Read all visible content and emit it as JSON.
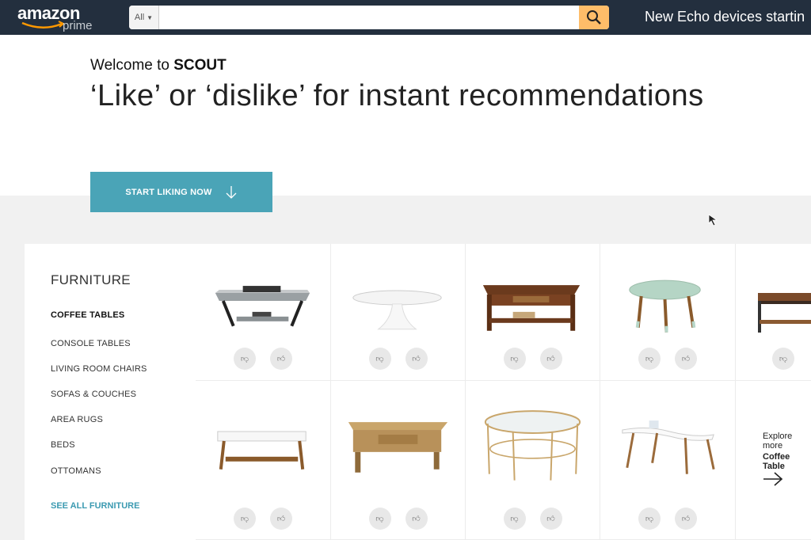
{
  "header": {
    "logo_word": "amazon",
    "logo_sub": "prime",
    "search_dept": "All",
    "search_placeholder": "",
    "promo": "New Echo devices startin"
  },
  "hero": {
    "welcome_prefix": "Welcome to",
    "welcome_brand": "SCOUT",
    "headline": "‘Like’ or ‘dislike’ for instant  recommendations",
    "cta_label": "START LIKING NOW"
  },
  "categories": {
    "title": "FURNITURE",
    "items": [
      "COFFEE TABLES",
      "CONSOLE TABLES",
      "LIVING ROOM CHAIRS",
      "SOFAS & COUCHES",
      "AREA RUGS",
      "BEDS",
      "OTTOMANS"
    ],
    "active": "COFFEE TABLES",
    "see_all": "SEE ALL FURNITURE"
  },
  "explore": {
    "line1": "Explore more",
    "line2": "Coffee Table"
  },
  "colors": {
    "header_bg": "#232f3e",
    "search_button": "#febd69",
    "accent_teal": "#4aa4b7",
    "link_teal": "#3b9ab1"
  },
  "icons": {
    "search": "magnifier-icon",
    "cta": "arrow-down-icon",
    "dislike": "thumbs-down-icon",
    "like": "thumbs-up-icon",
    "explore": "arrow-right-icon"
  }
}
